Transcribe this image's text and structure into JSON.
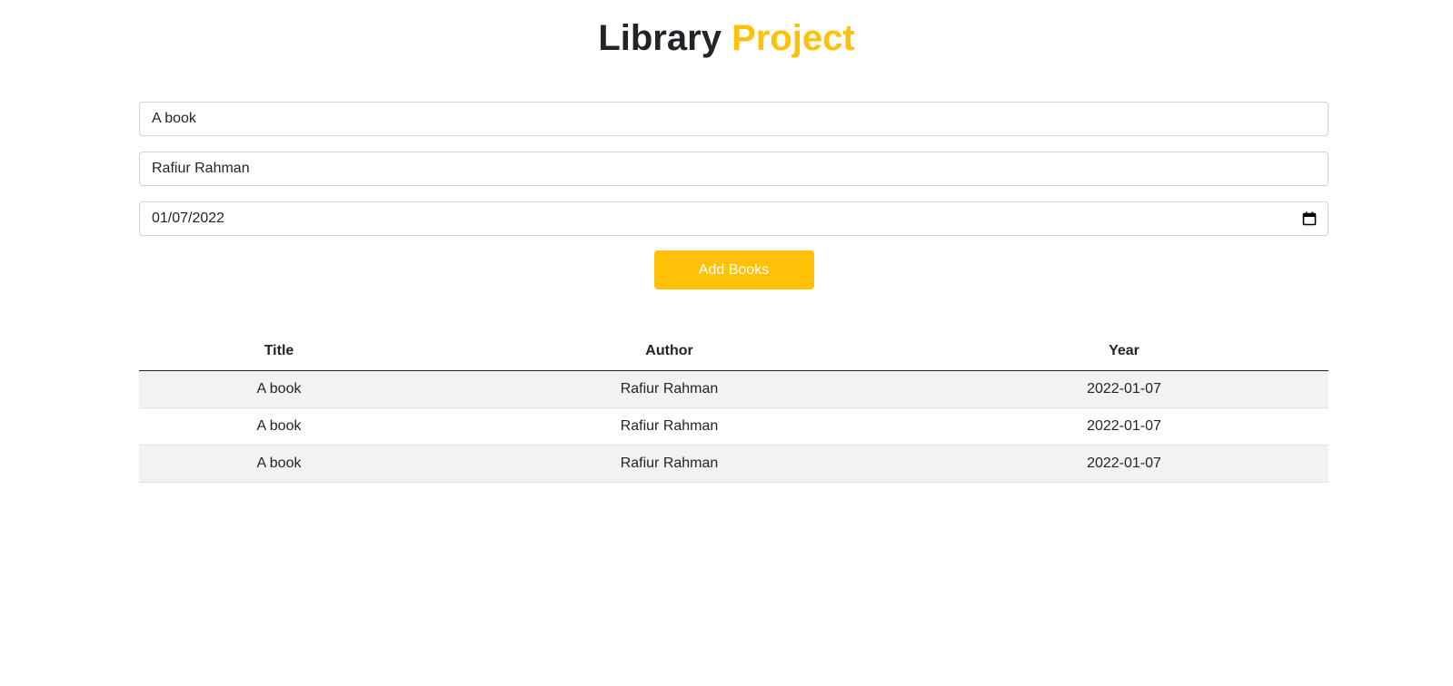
{
  "header": {
    "title_part1": "Library",
    "title_part2": "Project",
    "accent_color": "#ffc107"
  },
  "form": {
    "title_value": "A book",
    "author_value": "Rafiur Rahman",
    "date_value": "01/07/2022",
    "date_icon": "calendar-icon",
    "submit_label": "Add Books"
  },
  "table": {
    "headers": [
      "Title",
      "Author",
      "Year"
    ],
    "rows": [
      [
        "A book",
        "Rafiur Rahman",
        "2022-01-07"
      ],
      [
        "A book",
        "Rafiur Rahman",
        "2022-01-07"
      ],
      [
        "A book",
        "Rafiur Rahman",
        "2022-01-07"
      ]
    ]
  }
}
